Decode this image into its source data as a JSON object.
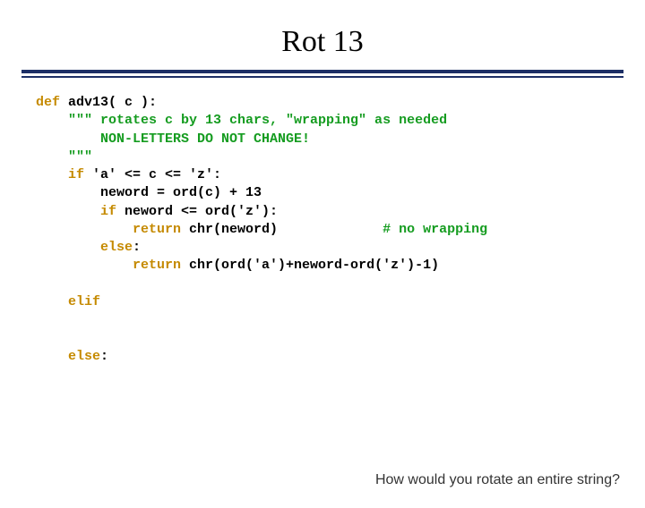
{
  "title": "Rot 13",
  "code": {
    "l01_def": "def",
    "l01_name": " adv13( c ):",
    "l02": "    \"\"\" rotates c by 13 chars, \"wrapping\" as needed",
    "l03": "        NON-LETTERS DO NOT CHANGE!",
    "l04": "    \"\"\"",
    "l05_if": "    if",
    "l05_rest": " 'a' <= c <= 'z':",
    "l06": "        neword = ord(c) + 13",
    "l07_if": "        if",
    "l07_rest": " neword <= ord('z'):",
    "l08_ret": "            return",
    "l08_rest": " chr(neword)",
    "l08_comment": "             # no wrapping",
    "l09_else": "        else",
    "l09_rest": ":",
    "l10_ret": "            return",
    "l10_rest": " chr(ord('a')+neword-ord('z')-1)",
    "blank1": " ",
    "l11_elif": "    elif",
    "blank2": " ",
    "blank3": " ",
    "l12_else": "    else",
    "l12_rest": ":"
  },
  "footer_question": "How would you rotate an entire string?"
}
